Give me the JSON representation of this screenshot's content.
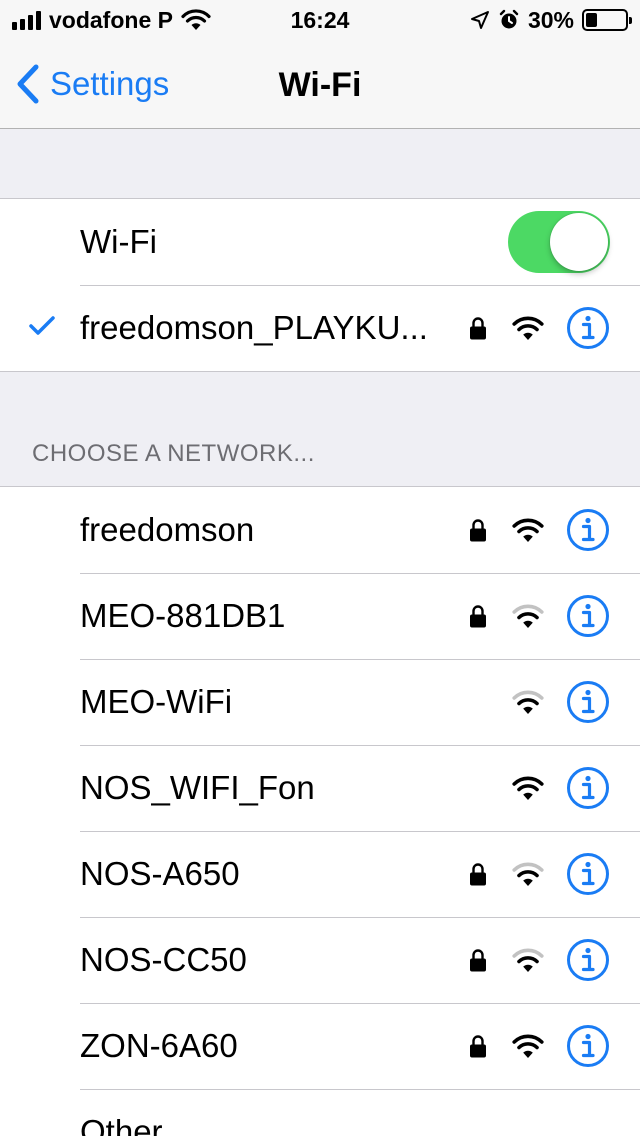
{
  "status_bar": {
    "carrier": "vodafone P",
    "time": "16:24",
    "battery_percent": "30%",
    "battery_level": 0.3,
    "icons": [
      "signal-bars-icon",
      "wifi-icon",
      "location-arrow-icon",
      "alarm-icon",
      "battery-icon"
    ]
  },
  "nav": {
    "back_label": "Settings",
    "title": "Wi-Fi"
  },
  "wifi_toggle": {
    "label": "Wi-Fi",
    "on": true,
    "color": "#4cd964"
  },
  "connected_network": {
    "name": "freedomson_PLAYKU...",
    "locked": true,
    "signal": "strong"
  },
  "section_header": "CHOOSE A NETWORK...",
  "networks": [
    {
      "name": "freedomson",
      "locked": true,
      "signal": "strong"
    },
    {
      "name": "MEO-881DB1",
      "locked": true,
      "signal": "weak"
    },
    {
      "name": "MEO-WiFi",
      "locked": false,
      "signal": "weak"
    },
    {
      "name": "NOS_WIFI_Fon",
      "locked": false,
      "signal": "strong"
    },
    {
      "name": "NOS-A650",
      "locked": true,
      "signal": "weak"
    },
    {
      "name": "NOS-CC50",
      "locked": true,
      "signal": "weak"
    },
    {
      "name": "ZON-6A60",
      "locked": true,
      "signal": "strong"
    }
  ],
  "other_label": "Other...",
  "colors": {
    "accent": "#1a7cf4",
    "background": "#efeff4",
    "separator": "#c8c7cc",
    "section_text": "#6d6d72"
  }
}
